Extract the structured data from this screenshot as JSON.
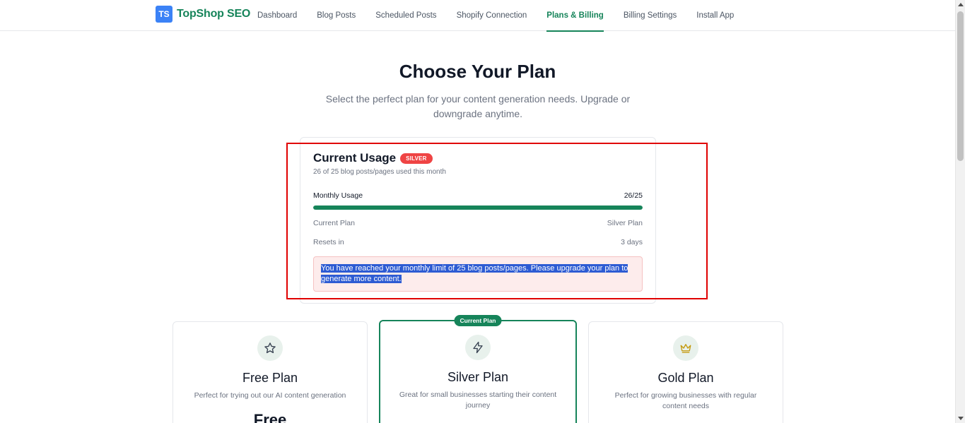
{
  "nav": {
    "logo_initials": "TS",
    "brand": "TopShop SEO",
    "links": [
      {
        "label": "Dashboard"
      },
      {
        "label": "Blog Posts"
      },
      {
        "label": "Scheduled Posts"
      },
      {
        "label": "Shopify Connection"
      },
      {
        "label": "Plans & Billing",
        "active": true
      },
      {
        "label": "Billing Settings"
      },
      {
        "label": "Install App"
      }
    ]
  },
  "header": {
    "title": "Choose Your Plan",
    "subtitle": "Select the perfect plan for your content generation needs. Upgrade or downgrade anytime."
  },
  "usage": {
    "title": "Current Usage",
    "badge": "SILVER",
    "summary": "26 of 25 blog posts/pages used this month",
    "monthly_label": "Monthly Usage",
    "monthly_value": "26/25",
    "progress_fraction": 1.0,
    "current_plan_label": "Current Plan",
    "current_plan_value": "Silver Plan",
    "resets_label": "Resets in",
    "resets_value": "3 days",
    "alert": "You have reached your monthly limit of 25 blog posts/pages. Please upgrade your plan to generate more content."
  },
  "plans": [
    {
      "name": "Free Plan",
      "description": "Perfect for trying out our AI content generation",
      "price": "Free",
      "icon": "star-icon"
    },
    {
      "name": "Silver Plan",
      "description": "Great for small businesses starting their content journey",
      "current_label": "Current Plan",
      "icon": "lightning-icon"
    },
    {
      "name": "Gold Plan",
      "description": "Perfect for growing businesses with regular content needs",
      "icon": "crown-icon"
    }
  ],
  "colors": {
    "brand": "#16845a",
    "badge_red": "#ef4444",
    "logo_blue": "#3b82f6",
    "alert_bg": "#fdecec"
  }
}
